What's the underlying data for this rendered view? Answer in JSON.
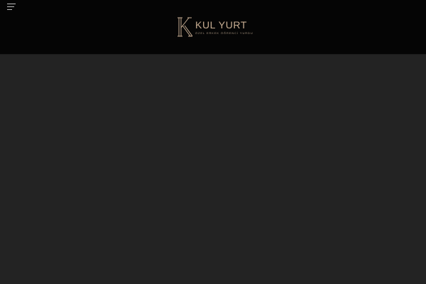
{
  "header": {
    "menu_icon": "hamburger-menu-icon",
    "logo": {
      "mark_letter": "K",
      "name": "KUL YURT",
      "tagline": "ÖZEL ERKEK ÖĞRENCİ YURDU"
    }
  },
  "colors": {
    "header_bg": "#050505",
    "page_bg": "#232323",
    "brand_gold": "#c7ad92"
  }
}
